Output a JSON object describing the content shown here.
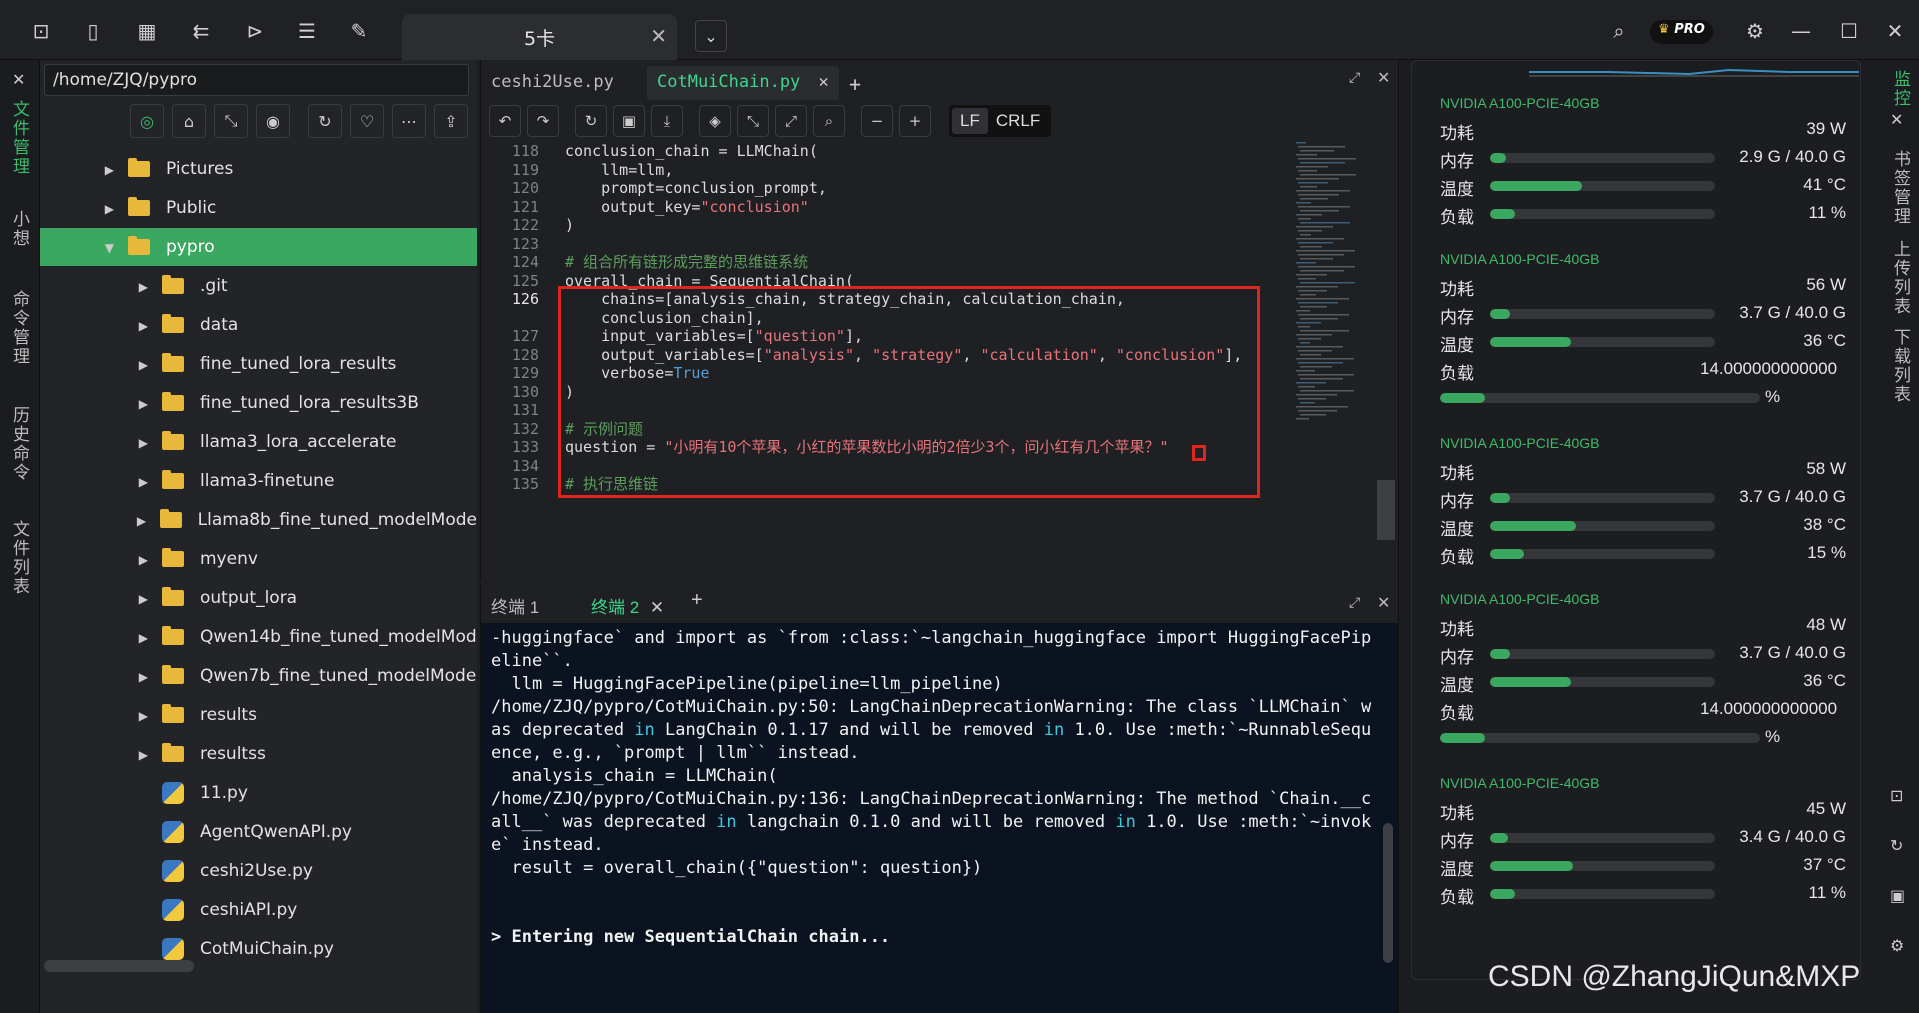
{
  "window": {
    "tab_title": "5卡",
    "pro_badge": "PRO"
  },
  "left_rail": [
    "文件管理",
    "小想",
    "命令管理",
    "历史命令",
    "文件列表"
  ],
  "file_panel": {
    "path": "/home/ZJQ/pypro",
    "items": [
      {
        "name": "Pictures",
        "type": "folder",
        "depth": 0
      },
      {
        "name": "Public",
        "type": "folder",
        "depth": 0
      },
      {
        "name": "pypro",
        "type": "folder",
        "depth": 0,
        "selected": true
      },
      {
        "name": ".git",
        "type": "folder",
        "depth": 1
      },
      {
        "name": "data",
        "type": "folder",
        "depth": 1
      },
      {
        "name": "fine_tuned_lora_results",
        "type": "folder",
        "depth": 1
      },
      {
        "name": "fine_tuned_lora_results3B",
        "type": "folder",
        "depth": 1
      },
      {
        "name": "llama3_lora_accelerate",
        "type": "folder",
        "depth": 1
      },
      {
        "name": "llama3-finetune",
        "type": "folder",
        "depth": 1
      },
      {
        "name": "Llama8b_fine_tuned_modelMode",
        "type": "folder",
        "depth": 1
      },
      {
        "name": "myenv",
        "type": "folder",
        "depth": 1
      },
      {
        "name": "output_lora",
        "type": "folder",
        "depth": 1
      },
      {
        "name": "Qwen14b_fine_tuned_modelMod",
        "type": "folder",
        "depth": 1
      },
      {
        "name": "Qwen7b_fine_tuned_modelMode",
        "type": "folder",
        "depth": 1
      },
      {
        "name": "results",
        "type": "folder",
        "depth": 1
      },
      {
        "name": "resultss",
        "type": "folder",
        "depth": 1
      },
      {
        "name": "11.py",
        "type": "python",
        "depth": 1
      },
      {
        "name": "AgentQwenAPI.py",
        "type": "python",
        "depth": 1
      },
      {
        "name": "ceshi2Use.py",
        "type": "python",
        "depth": 1
      },
      {
        "name": "ceshiAPI.py",
        "type": "python",
        "depth": 1
      },
      {
        "name": "CotMuiChain.py",
        "type": "python",
        "depth": 1
      }
    ]
  },
  "editor": {
    "tabs": [
      "ceshi2Use.py",
      "CotMuiChain.py"
    ],
    "eol": [
      "LF",
      "CRLF"
    ],
    "lines": [
      {
        "n": "118",
        "text": "conclusion_chain = LLMChain("
      },
      {
        "n": "119",
        "text": "    llm=llm,"
      },
      {
        "n": "120",
        "text": "    prompt=conclusion_prompt,"
      },
      {
        "n": "121",
        "text": "    output_key=\"conclusion\""
      },
      {
        "n": "122",
        "text": ")"
      },
      {
        "n": "123",
        "text": ""
      },
      {
        "n": "124",
        "text": "# 组合所有链形成完整的思维链系统"
      },
      {
        "n": "125",
        "text": "overall_chain = SequentialChain("
      },
      {
        "n": "126",
        "text": "    chains=[analysis_chain, strategy_chain, calculation_chain,"
      },
      {
        "n": "",
        "text": "    conclusion_chain],"
      },
      {
        "n": "127",
        "text": "    input_variables=[\"question\"],"
      },
      {
        "n": "128",
        "text": "    output_variables=[\"analysis\", \"strategy\", \"calculation\", \"conclusion\"],"
      },
      {
        "n": "129",
        "text": "    verbose=True"
      },
      {
        "n": "130",
        "text": ")"
      },
      {
        "n": "131",
        "text": ""
      },
      {
        "n": "132",
        "text": "# 示例问题"
      },
      {
        "n": "133",
        "text": "question = \"小明有10个苹果，小红的苹果数比小明的2倍少3个，问小红有几个苹果？\""
      },
      {
        "n": "134",
        "text": ""
      },
      {
        "n": "135",
        "text": "# 执行思维链"
      }
    ]
  },
  "terminal": {
    "tabs": [
      "终端 1",
      "终端 2"
    ],
    "output": [
      "-huggingface` and import as `from :class:`~langchain_huggingface import HuggingFacePipeline``.",
      "  llm = HuggingFacePipeline(pipeline=llm_pipeline)",
      "/home/ZJQ/pypro/CotMuiChain.py:50: LangChainDeprecationWarning: The class `LLMChain` was deprecated in LangChain 0.1.17 and will be removed in 1.0. Use :meth:`~RunnableSequence, e.g., `prompt | llm`` instead.",
      "  analysis_chain = LLMChain(",
      "/home/ZJQ/pypro/CotMuiChain.py:136: LangChainDeprecationWarning: The method `Chain.__call__` was deprecated in langchain 0.1.0 and will be removed in 1.0. Use :meth:`~invoke` instead.",
      "  result = overall_chain({\"question\": question})",
      "",
      "",
      "> Entering new SequentialChain chain..."
    ]
  },
  "gpu_panel": {
    "labels": {
      "power": "功耗",
      "memory": "内存",
      "temp": "温度",
      "load": "负载"
    },
    "cards": [
      {
        "name": "NVIDIA A100-PCIE-40GB",
        "power": "39 W",
        "memory": "2.9 G / 40.0 G",
        "mem_frac": 0.07,
        "temp": "41 °C",
        "temp_frac": 0.41,
        "load": "11 %",
        "load_frac": 0.11,
        "wrap": false
      },
      {
        "name": "NVIDIA A100-PCIE-40GB",
        "power": "56 W",
        "memory": "3.7 G / 40.0 G",
        "mem_frac": 0.09,
        "temp": "36 °C",
        "temp_frac": 0.36,
        "load": "14.000000000000",
        "load_unit": "%",
        "load_frac": 0.14,
        "wrap": true
      },
      {
        "name": "NVIDIA A100-PCIE-40GB",
        "power": "58 W",
        "memory": "3.7 G / 40.0 G",
        "mem_frac": 0.09,
        "temp": "38 °C",
        "temp_frac": 0.38,
        "load": "15 %",
        "load_frac": 0.15,
        "wrap": false
      },
      {
        "name": "NVIDIA A100-PCIE-40GB",
        "power": "48 W",
        "memory": "3.7 G / 40.0 G",
        "mem_frac": 0.09,
        "temp": "36 °C",
        "temp_frac": 0.36,
        "load": "14.000000000000",
        "load_unit": "%",
        "load_frac": 0.14,
        "wrap": true
      },
      {
        "name": "NVIDIA A100-PCIE-40GB",
        "power": "45 W",
        "memory": "3.4 G / 40.0 G",
        "mem_frac": 0.08,
        "temp": "37 °C",
        "temp_frac": 0.37,
        "load": "11 %",
        "load_frac": 0.11,
        "wrap": false
      }
    ]
  },
  "right_rail": [
    "监控",
    "书签管理",
    "上传列表",
    "下载列表"
  ],
  "watermark": "CSDN @ZhangJiQun&MXP",
  "colors": {
    "accent": "#3aa860",
    "highlight_box": "#e0251f"
  }
}
